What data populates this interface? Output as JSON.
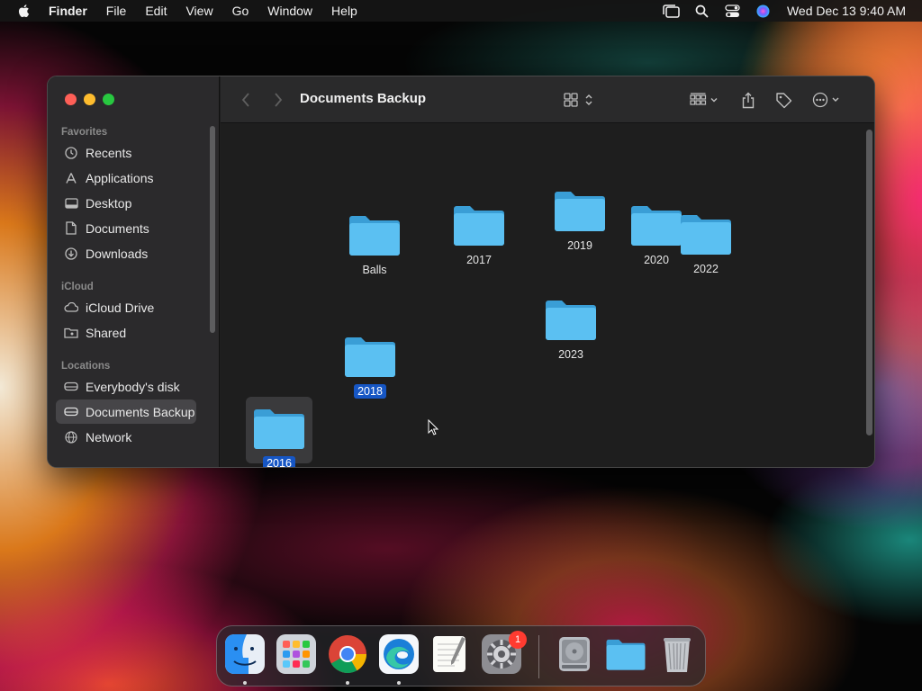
{
  "menubar": {
    "app_name": "Finder",
    "menus": [
      "File",
      "Edit",
      "View",
      "Go",
      "Window",
      "Help"
    ],
    "clock": "Wed Dec 13  9:40 AM"
  },
  "window": {
    "title": "Documents Backup",
    "sidebar": {
      "favorites_label": "Favorites",
      "favorites": [
        "Recents",
        "Applications",
        "Desktop",
        "Documents",
        "Downloads"
      ],
      "icloud_label": "iCloud",
      "icloud": [
        "iCloud Drive",
        "Shared"
      ],
      "locations_label": "Locations",
      "locations": [
        "Everybody's disk",
        "Documents Backup",
        "Network"
      ],
      "selected": "Documents Backup"
    },
    "folders": [
      {
        "name": "Balls",
        "selected": false
      },
      {
        "name": "2017",
        "selected": false
      },
      {
        "name": "2019",
        "selected": false
      },
      {
        "name": "2020",
        "selected": false
      },
      {
        "name": "2022",
        "selected": false
      },
      {
        "name": "2023",
        "selected": false
      },
      {
        "name": "2018",
        "selected": true
      },
      {
        "name": "2016",
        "selected": true
      }
    ]
  },
  "dock": {
    "apps": [
      "Finder",
      "Launchpad",
      "Google Chrome",
      "Microsoft Edge",
      "TextEdit",
      "System Preferences"
    ],
    "system_preferences_badge": "1",
    "right_items": [
      "Disk Utility",
      "Documents Folder",
      "Trash"
    ]
  },
  "colors": {
    "folder": "#4fb3e9",
    "selection": "#1656c4",
    "sidebar_selection": "#464548",
    "close": "#fe5f57",
    "minimize": "#febc2e",
    "maximize": "#28c840"
  }
}
